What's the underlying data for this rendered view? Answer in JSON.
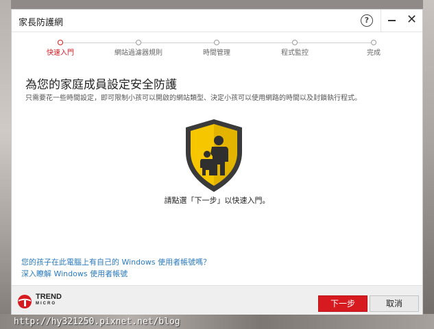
{
  "window": {
    "title": "家長防護網"
  },
  "titlebar": {
    "help_label": "?",
    "close_label": "✕"
  },
  "steps": [
    {
      "label": "快速入門",
      "active": true
    },
    {
      "label": "網站過濾器規則",
      "active": false
    },
    {
      "label": "時間管理",
      "active": false
    },
    {
      "label": "程式監控",
      "active": false
    },
    {
      "label": "完成",
      "active": false
    }
  ],
  "main": {
    "heading": "為您的家庭成員設定安全防護",
    "subheading": "只需要花一些時間設定，即可限制小孩可以開啟的網站類型、決定小孩可以使用網路的時間以及封鎖執行程式。",
    "shield_icon": "family-shield-icon",
    "instruction": "請點選「下一步」以快速入門。"
  },
  "links": [
    "您的孩子在此電腦上有自己的 Windows 使用者帳號嗎？",
    "深入瞭解 Windows 使用者帳號"
  ],
  "footer": {
    "brand": "TREND",
    "brand_sub": "MICRO",
    "next_label": "下一步",
    "cancel_label": "取消"
  },
  "watermark": "http://hy321250.pixnet.net/blog",
  "colors": {
    "accent": "#d71920",
    "link": "#2a7bc0",
    "shield": "#f6c600"
  }
}
